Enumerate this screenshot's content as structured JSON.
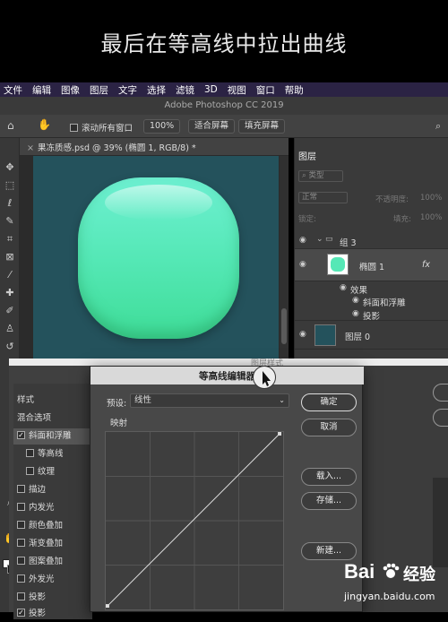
{
  "caption": "最后在等高线中拉出曲线",
  "menubar": [
    "文件",
    "编辑",
    "图像",
    "图层",
    "文字",
    "选择",
    "滤镜",
    "3D",
    "视图",
    "窗口",
    "帮助"
  ],
  "app_title": "Adobe Photoshop CC 2019",
  "options_bar": {
    "scroll_all": "滚动所有窗口",
    "zoom": "100%",
    "fit_screen": "适合屏幕",
    "fill_screen": "填充屏幕"
  },
  "document_tab": "果冻质感.psd @ 39% (椭圆 1, RGB/8) *",
  "layers_panel": {
    "title": "图层",
    "kind_filter": "类型",
    "blend_mode": "正常",
    "opacity_label": "不透明度:",
    "opacity": "100%",
    "lock_label": "锁定:",
    "fill_label": "填充:",
    "fill": "100%",
    "layers": [
      {
        "name": "组 3",
        "type": "group"
      },
      {
        "name": "椭圆 1",
        "fx": "fx"
      },
      {
        "name": "效果",
        "type": "effects"
      },
      {
        "name": "斜面和浮雕",
        "type": "effect"
      },
      {
        "name": "投影",
        "type": "effect"
      },
      {
        "name": "图层 0"
      }
    ]
  },
  "layer_style": {
    "title": "图层样式",
    "items": [
      {
        "label": "样式",
        "checkbox": false
      },
      {
        "label": "混合选项",
        "checkbox": false
      },
      {
        "label": "斜面和浮雕",
        "checkbox": true,
        "checked": true
      },
      {
        "label": "等高线",
        "checkbox": true,
        "checked": false
      },
      {
        "label": "纹理",
        "checkbox": true,
        "checked": false
      },
      {
        "label": "描边",
        "checkbox": true,
        "checked": false
      },
      {
        "label": "内发光",
        "checkbox": true,
        "checked": false
      },
      {
        "label": "颜色叠加",
        "checkbox": true,
        "checked": false
      },
      {
        "label": "渐变叠加",
        "checkbox": true,
        "checked": false
      },
      {
        "label": "图案叠加",
        "checkbox": true,
        "checked": false
      },
      {
        "label": "外发光",
        "checkbox": true,
        "checked": false
      },
      {
        "label": "投影",
        "checkbox": true,
        "checked": false
      },
      {
        "label": "投影",
        "checkbox": true,
        "checked": true
      }
    ]
  },
  "curves_dialog": {
    "title": "等高线编辑器",
    "preset_label": "预设:",
    "preset_value": "线性",
    "mapping_label": "映射",
    "buttons": {
      "ok": "确定",
      "cancel": "取消",
      "load": "载入...",
      "save": "存储...",
      "new": "新建..."
    }
  },
  "watermark": {
    "brand": "Bai",
    "brand2": "经验",
    "url": "jingyan.baidu.com"
  },
  "colors": {
    "jelly": "#55e8b6",
    "canvas": "#24525c",
    "menubar": "#2b2344"
  }
}
